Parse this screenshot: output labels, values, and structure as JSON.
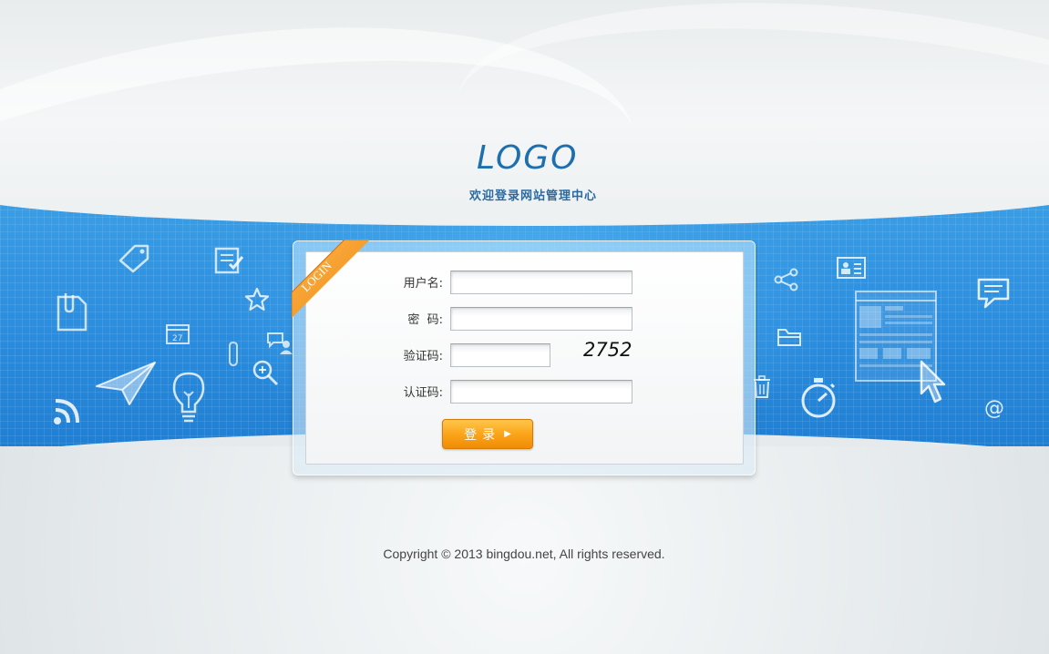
{
  "header": {
    "logo_text": "LOGO",
    "subtitle": "欢迎登录网站管理中心"
  },
  "login_panel": {
    "ribbon_text": "LOGIN",
    "username_label": "用户名:",
    "username_value": "",
    "password_label": "密  码:",
    "password_value": "",
    "verify_label": "验证码:",
    "verify_value": "",
    "captcha_text": "2752",
    "auth_label": "认证码:",
    "auth_value": "",
    "login_button_label": "登录"
  },
  "footer": {
    "copyright": "Copyright © 2013 bingdou.net, All rights reserved."
  },
  "colors": {
    "band_blue": "#2c8fe0",
    "logo_blue": "#1d6fae",
    "button_orange": "#fba51a",
    "ribbon_orange": "#f39b1f"
  },
  "icons": [
    "tag-icon",
    "notepad-icon",
    "clipboard-icon",
    "star-icon",
    "calendar-icon",
    "chat-user-icon",
    "paperclip-icon",
    "zoom-icon",
    "paper-plane-icon",
    "lightbulb-icon",
    "rss-icon",
    "share-icon",
    "id-card-icon",
    "speech-bubble-icon",
    "folder-icon",
    "webpage-icon",
    "cursor-icon",
    "trash-icon",
    "stopwatch-icon",
    "at-icon"
  ]
}
